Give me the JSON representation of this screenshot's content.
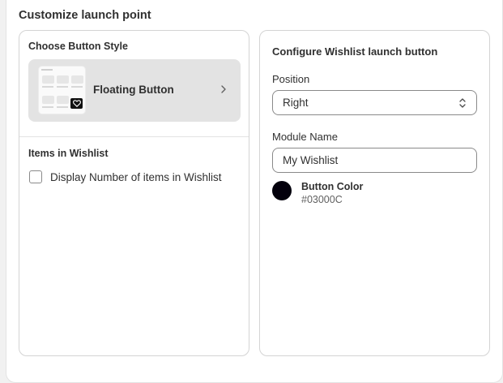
{
  "page": {
    "title": "Customize launch point"
  },
  "left_panel": {
    "button_style_heading": "Choose Button Style",
    "selected_style": "Floating Button",
    "items_heading": "Items in Wishlist",
    "checkbox_label": "Display Number of items in Wishlist",
    "checkbox_checked": false
  },
  "right_panel": {
    "heading": "Configure Wishlist launch button",
    "position_label": "Position",
    "position_value": "Right",
    "module_name_label": "Module Name",
    "module_name_value": "My Wishlist",
    "button_color_label": "Button Color",
    "button_color_value": "#03000C"
  },
  "icons": {
    "style_thumbnail": "wishlist-preview-thumbnail",
    "thumbnail_badge": "heart-icon",
    "style_arrow": "chevron-right-icon",
    "select_arrow": "select-chevron-icon"
  }
}
